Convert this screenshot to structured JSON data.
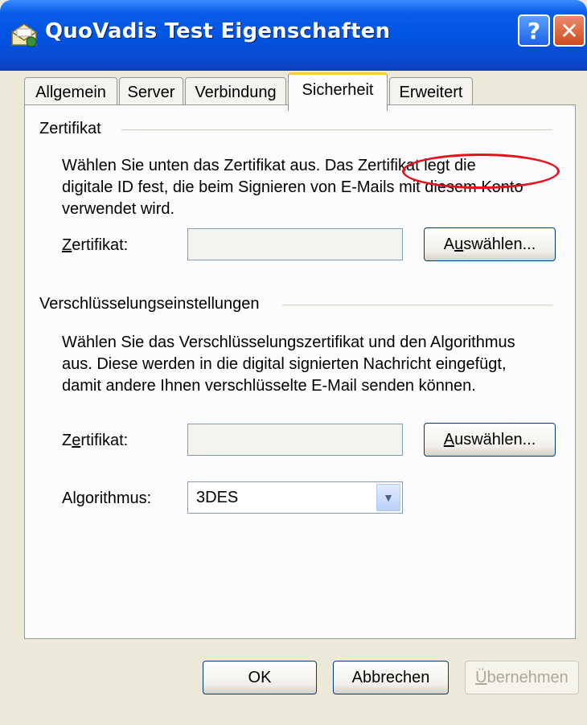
{
  "window": {
    "title": "QuoVadis Test Eigenschaften",
    "help_label": "?",
    "close_label": "✕"
  },
  "tabs": [
    {
      "label": "Allgemein",
      "active": false
    },
    {
      "label": "Server",
      "active": false
    },
    {
      "label": "Verbindung",
      "active": false
    },
    {
      "label": "Sicherheit",
      "active": true
    },
    {
      "label": "Erweitert",
      "active": false
    }
  ],
  "cert_section": {
    "title": "Zertifikat",
    "description_lines": [
      "Wählen Sie unten das Zertifikat aus. Das Zertifikat legt die",
      "digitale ID fest, die beim Signieren von E-Mails mit diesem Konto",
      "verwendet wird."
    ],
    "label_pre": "",
    "label_mnemonic": "Z",
    "label_post": "ertifikat:",
    "value": "",
    "button_label_pre": "A",
    "button_label_mnemonic": "u",
    "button_label_post": "swählen..."
  },
  "encryption_section": {
    "title": "Verschlüsselungseinstellungen",
    "description_lines": [
      "Wählen Sie das Verschlüsselungszertifikat und den Algorithmus",
      "aus. Diese werden in die digital signierten Nachricht eingefügt,",
      "damit andere Ihnen verschlüsselte E-Mail senden können."
    ],
    "label_pre": "Z",
    "label_mnemonic": "e",
    "label_post": "rtifikat:",
    "value": "",
    "button_label_pre": "",
    "button_label_mnemonic": "A",
    "button_label_post": "uswählen...",
    "algorithm_label": "Algorithmus:",
    "algorithm_value": "3DES"
  },
  "footer": {
    "ok": "OK",
    "cancel": "Abbrechen",
    "apply_mnemonic": "Ü",
    "apply_post": "bernehmen"
  },
  "colors": {
    "highlight": "#E0141E",
    "titlebar": "#0054E3",
    "active_tab_accent": "#FFC83C"
  }
}
